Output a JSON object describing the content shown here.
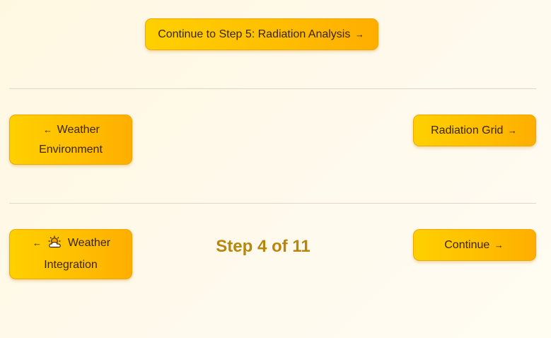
{
  "top": {
    "continue_step5_label": "Continue to Step 5: Radiation Analysis",
    "arrow_right": "→"
  },
  "row1": {
    "prev_arrow": "←",
    "prev_line1": "Weather",
    "prev_line2": "Environment",
    "next_label": "Radiation Grid",
    "next_arrow": "→"
  },
  "row2": {
    "prev_arrow": "←",
    "prev_icon": "sun-behind-cloud-icon",
    "prev_line1": "Weather",
    "prev_line2": "Integration",
    "step_text": "Step 4 of 11",
    "next_label": "Continue",
    "next_arrow": "→"
  },
  "colors": {
    "button_gradient_start": "#ffd000",
    "button_gradient_end": "#ffae00",
    "step_text": "#b8860b",
    "background": "#fff8e1"
  }
}
